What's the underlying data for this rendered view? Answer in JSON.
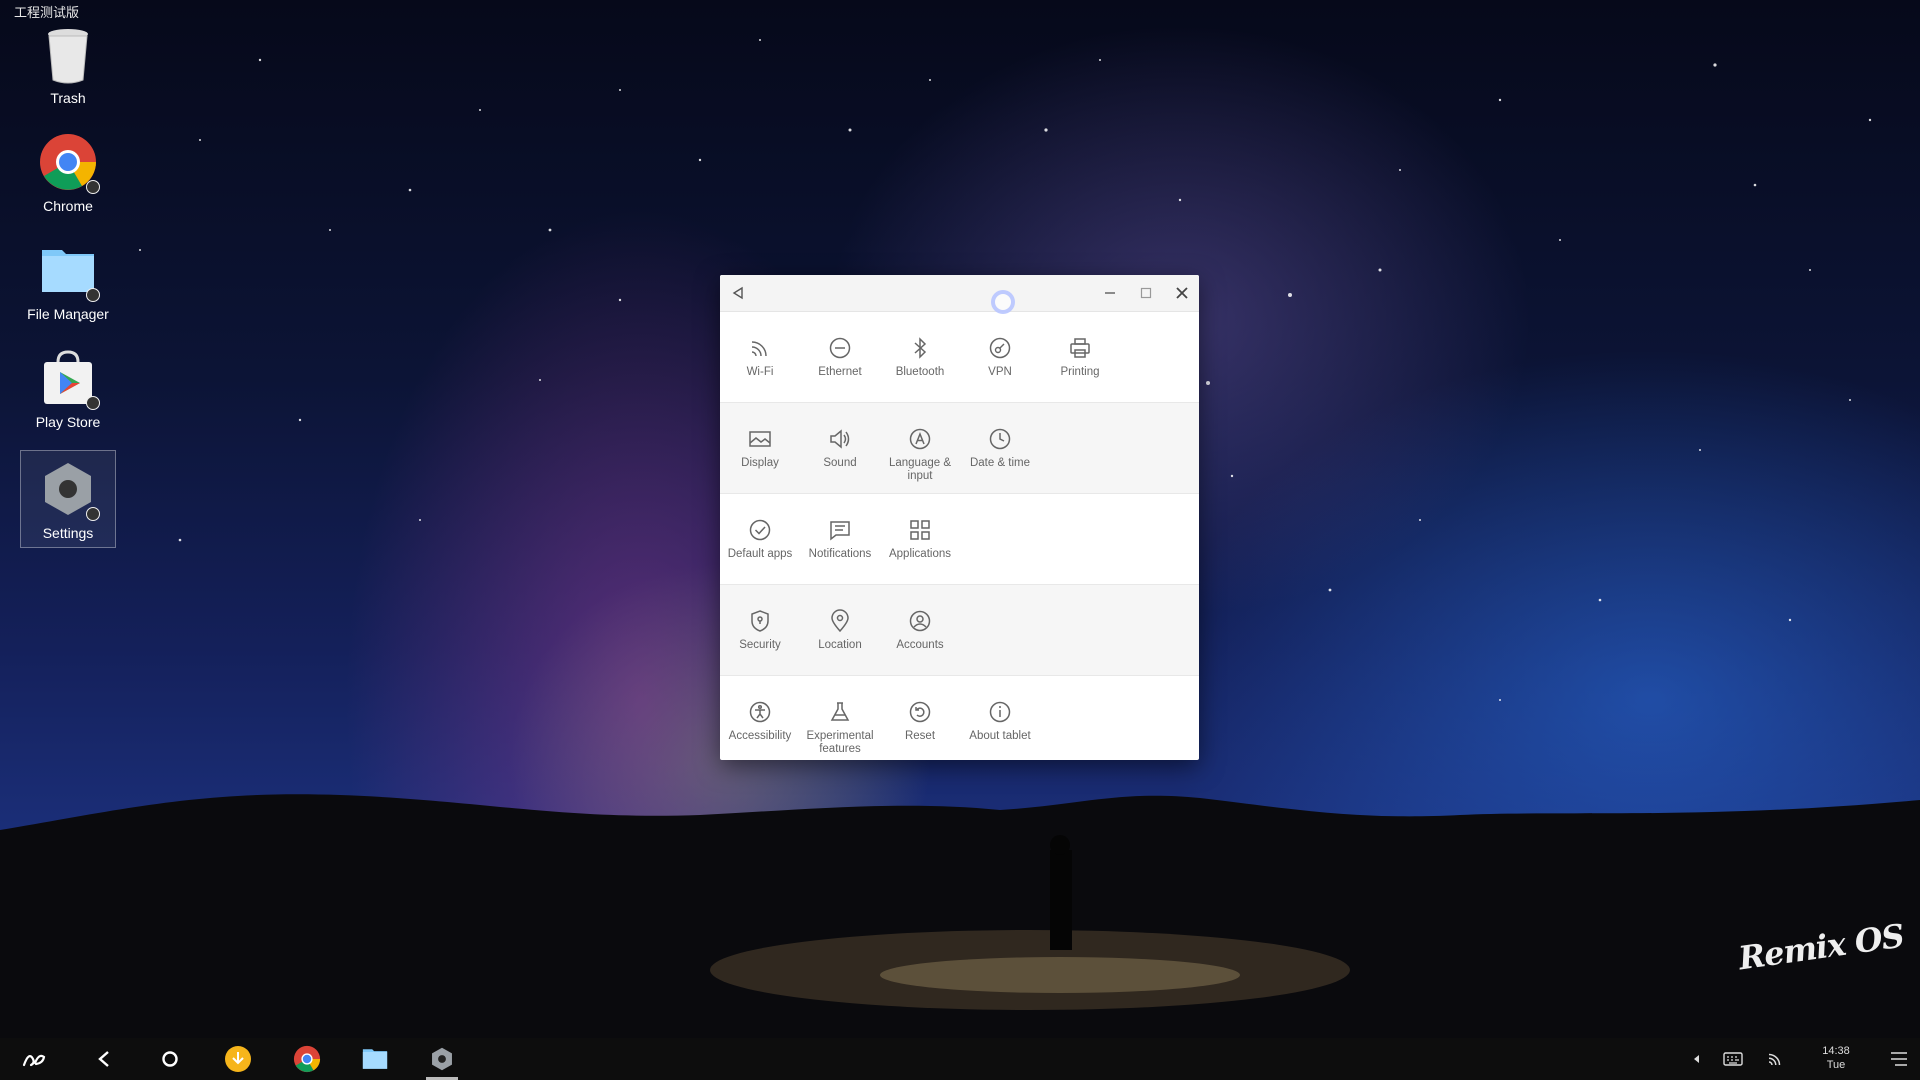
{
  "system": {
    "corner_label": "工程测试版",
    "watermark": "Remix OS"
  },
  "desktop_icons": [
    {
      "label": "Trash"
    },
    {
      "label": "Chrome"
    },
    {
      "label": "File Manager"
    },
    {
      "label": "Play Store"
    },
    {
      "label": "Settings"
    }
  ],
  "settings_window": {
    "sections": [
      [
        {
          "label": "Wi-Fi",
          "icon": "wifi-icon"
        },
        {
          "label": "Ethernet",
          "icon": "ethernet-icon"
        },
        {
          "label": "Bluetooth",
          "icon": "bluetooth-icon"
        },
        {
          "label": "VPN",
          "icon": "vpn-icon"
        },
        {
          "label": "Printing",
          "icon": "printer-icon"
        }
      ],
      [
        {
          "label": "Display",
          "icon": "display-icon"
        },
        {
          "label": "Sound",
          "icon": "speaker-icon"
        },
        {
          "label": "Language & input",
          "icon": "language-icon"
        },
        {
          "label": "Date & time",
          "icon": "clock-icon"
        }
      ],
      [
        {
          "label": "Default apps",
          "icon": "check-circle-icon"
        },
        {
          "label": "Notifications",
          "icon": "notification-icon"
        },
        {
          "label": "Applications",
          "icon": "apps-grid-icon"
        }
      ],
      [
        {
          "label": "Security",
          "icon": "shield-icon"
        },
        {
          "label": "Location",
          "icon": "location-pin-icon"
        },
        {
          "label": "Accounts",
          "icon": "account-icon"
        }
      ],
      [
        {
          "label": "Accessibility",
          "icon": "accessibility-icon"
        },
        {
          "label": "Experimental features",
          "icon": "flask-icon"
        },
        {
          "label": "Reset",
          "icon": "reset-icon"
        },
        {
          "label": "About tablet",
          "icon": "info-icon"
        }
      ]
    ]
  },
  "taskbar": {
    "clock_time": "14:38",
    "clock_day": "Tue"
  }
}
